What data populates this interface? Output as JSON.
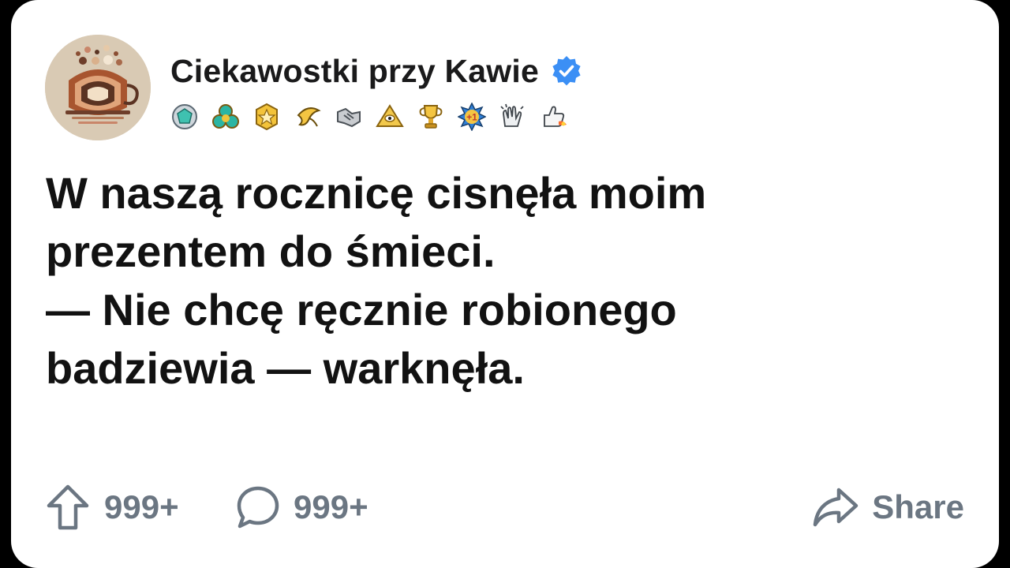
{
  "post": {
    "author": {
      "name": "Ciekawostki przy Kawie",
      "verified": true,
      "verified_color": "#3b8ff5"
    },
    "avatar": {
      "icon": "coffee-cup-logo-icon"
    },
    "badges": [
      {
        "name": "gem-badge-icon"
      },
      {
        "name": "trefoil-badge-icon"
      },
      {
        "name": "star-medal-badge-icon"
      },
      {
        "name": "banana-hand-badge-icon"
      },
      {
        "name": "handshake-badge-icon"
      },
      {
        "name": "pyramid-badge-icon"
      },
      {
        "name": "trophy-badge-icon"
      },
      {
        "name": "plus-one-badge-icon"
      },
      {
        "name": "clapping-hands-badge-icon"
      },
      {
        "name": "thumbs-up-rocket-badge-icon"
      }
    ],
    "text_lines": [
      "W naszą rocznicę cisnęła moim",
      "prezentem do śmieci.",
      "— Nie chcę ręcznie robionego",
      "badziewia — warknęła."
    ]
  },
  "actions": {
    "upvotes": "999+",
    "comments": "999+",
    "share_label": "Share",
    "icon_color": "#6b7682"
  }
}
